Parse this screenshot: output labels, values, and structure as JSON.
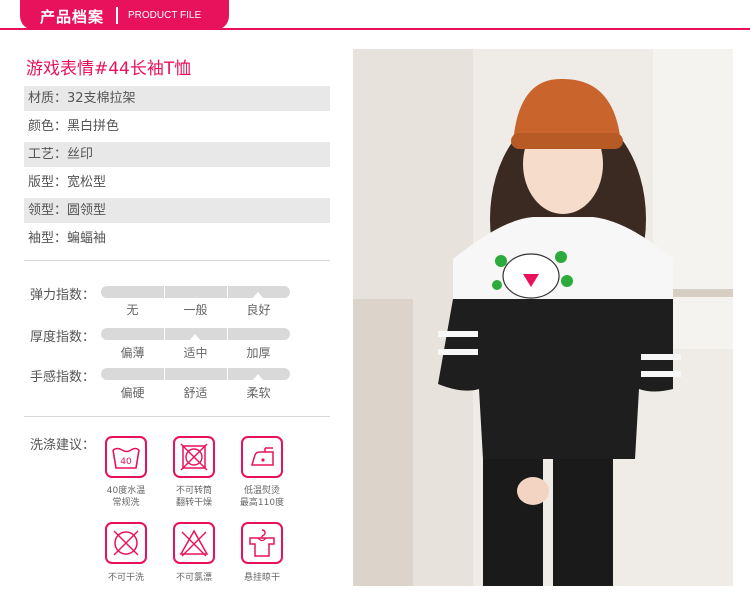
{
  "header": {
    "title_cn": "产品档案",
    "title_en": "PRODUCT FILE"
  },
  "product": {
    "title": "游戏表情#44长袖T恤"
  },
  "attributes": [
    {
      "text": "材质：32支棉拉架"
    },
    {
      "text": "颜色：黑白拼色"
    },
    {
      "text": "工艺：丝印"
    },
    {
      "text": "版型：宽松型"
    },
    {
      "text": "领型：圆领型"
    },
    {
      "text": "袖型：蝙蝠袖"
    }
  ],
  "indices": [
    {
      "label": "弹力指数：",
      "options": [
        "无",
        "一般",
        "良好"
      ],
      "selected_index": 2
    },
    {
      "label": "厚度指数：",
      "options": [
        "偏薄",
        "适中",
        "加厚"
      ],
      "selected_index": 1
    },
    {
      "label": "手感指数：",
      "options": [
        "偏硬",
        "舒适",
        "柔软"
      ],
      "selected_index": 2
    }
  ],
  "wash": {
    "label": "洗涤建议：",
    "items": [
      {
        "icon": "wash-40-icon",
        "temp": "40",
        "caption": "40度水温\n常规洗"
      },
      {
        "icon": "no-tumble-dry-icon",
        "caption": "不可转筒\n翻转干燥"
      },
      {
        "icon": "low-iron-icon",
        "caption": "低温熨烫\n最高110度"
      },
      {
        "icon": "no-wash-icon",
        "caption": "不可干洗"
      },
      {
        "icon": "no-bleach-icon",
        "caption": "不可氯漂"
      },
      {
        "icon": "hang-dry-icon",
        "caption": "悬挂晾干"
      }
    ]
  },
  "colors": {
    "accent": "#e8125c",
    "shade": "#e8e8e8",
    "track": "#d9d9d9"
  }
}
